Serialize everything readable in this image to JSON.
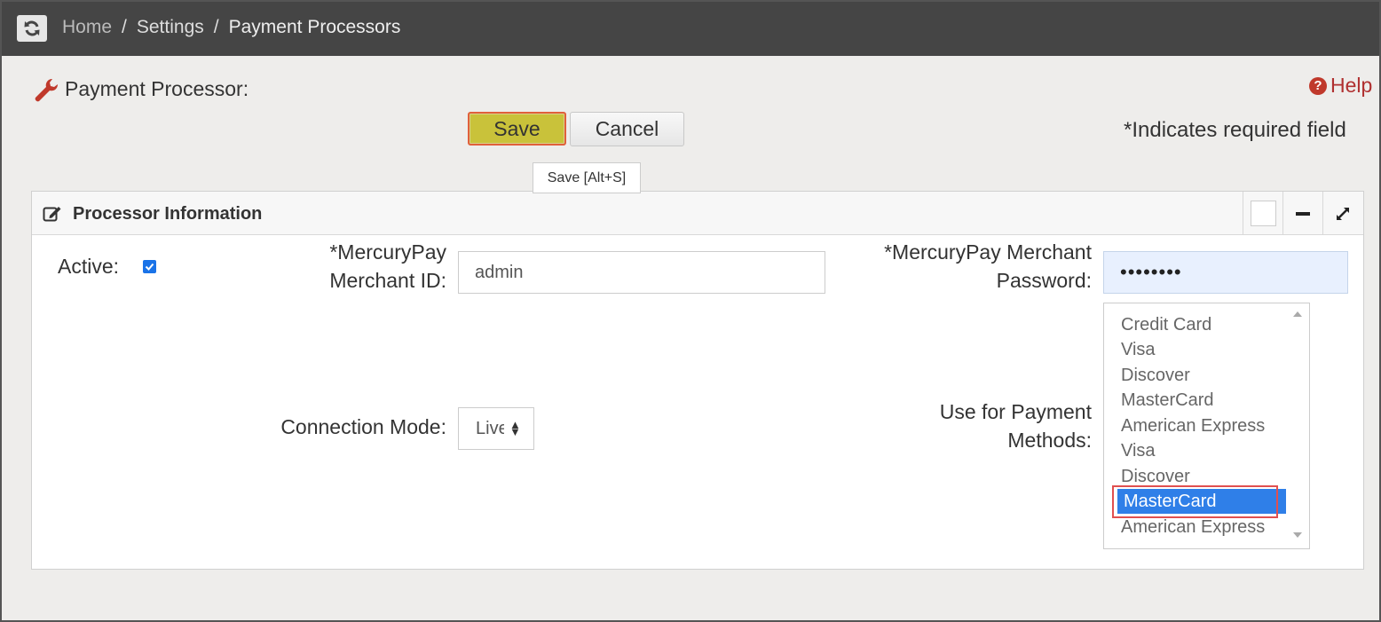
{
  "breadcrumb": {
    "items": [
      "Home",
      "Settings",
      "Payment Processors"
    ],
    "separator": "/"
  },
  "page": {
    "title": "Payment Processor:",
    "help_label": "Help",
    "required_note": "*Indicates required field"
  },
  "toolbar": {
    "save_label": "Save",
    "cancel_label": "Cancel",
    "save_tooltip": "Save [Alt+S]"
  },
  "panel": {
    "title": "Processor Information"
  },
  "form": {
    "active_label": "Active:",
    "active_checked": true,
    "merchant_id_label": "*MercuryPay Merchant ID:",
    "merchant_id_value": "admin",
    "password_label": "*MercuryPay Merchant Password:",
    "password_value": "••••••••",
    "connection_mode_label": "Connection Mode:",
    "connection_mode_value": "Live",
    "payment_methods_label": "Use for Payment Methods:",
    "payment_methods": [
      "Credit Card",
      "Visa",
      "Discover",
      "MasterCard",
      "American Express",
      "Visa",
      "Discover",
      "MasterCard",
      "American Express"
    ],
    "payment_methods_selected": "MasterCard"
  },
  "icons": {
    "refresh": "refresh-icon",
    "wrench": "wrench-icon",
    "help": "help-icon",
    "edit": "edit-icon",
    "minimize": "minus-icon",
    "expand": "expand-icon"
  },
  "colors": {
    "topbar": "#454545",
    "save_button": "#c9c23a",
    "highlight_border": "#e05050",
    "selected_item": "#2f7fe8",
    "help": "#b03030"
  }
}
